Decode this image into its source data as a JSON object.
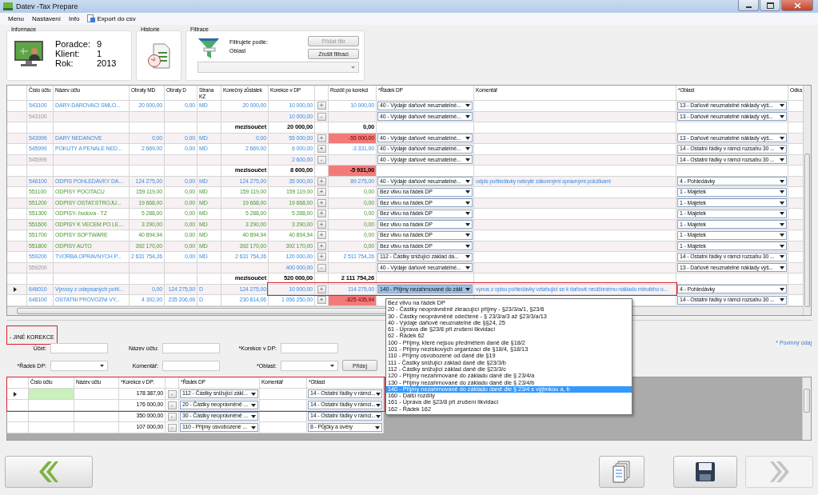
{
  "window": {
    "title": "Datev -Tax Prepare"
  },
  "menu": [
    "Menu",
    "Nastavení",
    "Info",
    "Export do csv"
  ],
  "info_group": {
    "title": "Informace",
    "fields": [
      {
        "label": "Poradce:",
        "value": "9"
      },
      {
        "label": "Klient:",
        "value": "1"
      },
      {
        "label": "Rok:",
        "value": "2013"
      }
    ]
  },
  "history_group": {
    "title": "Historie"
  },
  "filter_group": {
    "title": "Filtrace",
    "caption": "Filtrujete podle:",
    "value": "Oblast",
    "add_button": {
      "label": "Přidat filtr",
      "disabled": true
    },
    "cancel_button": {
      "label": "Zrušit filtraci",
      "disabled": false
    }
  },
  "main_grid": {
    "columns": [
      "Číslo účtu",
      "Název účtu",
      "Obraty MD",
      "Obraty D",
      "Strana KZ",
      "Konečný zůstatek",
      "Korekce v DP",
      "Rozdíl po korekci",
      "*Řádek DP",
      "Komentář",
      "*Oblast",
      "Odka"
    ],
    "rows": [
      {
        "kind": "account",
        "selected": false,
        "cislo": "543100",
        "nazev": "DARY-DAROVACI SMLO...",
        "md": "20 000,00",
        "d": "0,00",
        "strana": "MD",
        "konecny": "20 000,00",
        "korekce": "10 000,00",
        "button": "+",
        "rozdil": "10 000,00",
        "rozdil_alert": false,
        "radek": "40 - Výdaje daňově neuznatelné...",
        "oblast": "13 - Daňově neuznatelné náklady výš..."
      },
      {
        "kind": "split",
        "selected": false,
        "cislo": "543100",
        "korekce": "10 000,00",
        "button": "-",
        "radek": "40 - Výdaje daňově neuznatelné...",
        "oblast": "13 - Daňově neuznatelné náklady výš..."
      },
      {
        "kind": "subtotal",
        "selected": false,
        "label": "mezisoučet",
        "korekce": "20 000,00",
        "rozdil": "0,00",
        "rozdil_alert": false
      },
      {
        "kind": "account",
        "selected": false,
        "cislo": "543999",
        "nazev": "DARY NEDANOVE",
        "md": "0,00",
        "d": "0,00",
        "strana": "MD",
        "konecny": "0,00",
        "korekce": "55 000,00",
        "button": "+",
        "rozdil": "-55 000,00",
        "rozdil_alert": true,
        "radek": "40 - Výdaje daňově neuznatelné...",
        "oblast": "13 - Daňově neuznatelné náklady výš..."
      },
      {
        "kind": "account",
        "selected": false,
        "cislo": "545999",
        "nazev": "POKUTY A PENALE NED...",
        "md": "2 669,00",
        "d": "0,00",
        "strana": "MD",
        "konecny": "2 669,00",
        "korekce": "6 000,00",
        "button": "+",
        "rozdil": "-3 331,00",
        "rozdil_alert": false,
        "radek": "40 - Výdaje daňově neuznatelné...",
        "oblast": "14 - Ostatní řádky v rámci rozsahu 30 ..."
      },
      {
        "kind": "split",
        "selected": false,
        "cislo": "545999",
        "korekce": "2 600,00",
        "button": "-",
        "radek": "40 - Výdaje daňově neuznatelné...",
        "oblast": "14 - Ostatní řádky v rámci rozsahu 30 ..."
      },
      {
        "kind": "subtotal",
        "selected": false,
        "label": "mezisoučet",
        "korekce": "8 600,00",
        "rozdil": "-5 931,00",
        "rozdil_alert": true
      },
      {
        "kind": "account",
        "selected": false,
        "cislo": "546100",
        "nazev": "ODPIS POHLEDAVKY DA...",
        "md": "124 275,00",
        "d": "0,00",
        "strana": "MD",
        "konecny": "124 275,00",
        "korekce": "35 000,00",
        "button": "+",
        "rozdil": "89 275,00",
        "rozdil_alert": false,
        "radek": "40 - Výdaje daňově neuznatelné...",
        "komentar": "odpis pohledávky nekryté zákonnými opravnými položkami",
        "oblast": "4 - Pohledávky"
      },
      {
        "kind": "depreciation",
        "selected": false,
        "cislo": "551100",
        "nazev": "ODPISY POCITACU",
        "md": "159 119,00",
        "d": "0,00",
        "strana": "MD",
        "konecny": "159 119,00",
        "korekce": "159 119,00",
        "button": "+",
        "rozdil": "0,00",
        "rozdil_alert": false,
        "radek": "Bez vlivu na řádek DP",
        "oblast": "1 - Majetek"
      },
      {
        "kind": "depreciation",
        "selected": false,
        "cislo": "551200",
        "nazev": "ODPISY OSTAT.STROJU...",
        "md": "19 668,00",
        "d": "0,00",
        "strana": "MD",
        "konecny": "19 668,00",
        "korekce": "19 668,00",
        "button": "+",
        "rozdil": "0,00",
        "rozdil_alert": false,
        "radek": "Bez vlivu na řádek DP",
        "oblast": "1 - Majetek"
      },
      {
        "kind": "depreciation",
        "selected": false,
        "cislo": "551300",
        "nazev": "ODPISY- budova - TZ",
        "md": "5 288,00",
        "d": "0,00",
        "strana": "MD",
        "konecny": "5 288,00",
        "korekce": "5 288,00",
        "button": "+",
        "rozdil": "0,00",
        "rozdil_alert": false,
        "radek": "Bez vlivu na řádek DP",
        "oblast": "1 - Majetek"
      },
      {
        "kind": "depreciation",
        "selected": false,
        "cislo": "551600",
        "nazev": "ODPISY K VECEM PO LE...",
        "md": "3 290,00",
        "d": "0,00",
        "strana": "MD",
        "konecny": "3 290,00",
        "korekce": "3 290,00",
        "button": "+",
        "rozdil": "0,00",
        "rozdil_alert": false,
        "radek": "Bez vlivu na řádek DP",
        "oblast": "1 - Majetek"
      },
      {
        "kind": "depreciation",
        "selected": false,
        "cislo": "551700",
        "nazev": "ODPISY SOFTWARE",
        "md": "40 894,94",
        "d": "0,00",
        "strana": "MD",
        "konecny": "40 894,94",
        "korekce": "40 894,94",
        "button": "+",
        "rozdil": "0,00",
        "rozdil_alert": false,
        "radek": "Bez vlivu na řádek DP",
        "oblast": "1 - Majetek"
      },
      {
        "kind": "depreciation",
        "selected": false,
        "cislo": "551800",
        "nazev": "ODPISY AUTO",
        "md": "392 170,00",
        "d": "0,00",
        "strana": "MD",
        "konecny": "392 170,00",
        "korekce": "392 170,00",
        "button": "+",
        "rozdil": "0,00",
        "rozdil_alert": false,
        "radek": "Bez vlivu na řádek DP",
        "oblast": "1 - Majetek"
      },
      {
        "kind": "account",
        "selected": false,
        "cislo": "559200",
        "nazev": "TVORBA OPRAVNYCH P...",
        "md": "2 631 754,26",
        "d": "0,00",
        "strana": "MD",
        "konecny": "2 631 754,26",
        "korekce": "120 000,00",
        "button": "+",
        "rozdil": "2 511 754,26",
        "rozdil_alert": false,
        "radek": "112 - Částky snižující základ da...",
        "oblast": "14 - Ostatní řádky v rámci rozsahu 30 ..."
      },
      {
        "kind": "split",
        "selected": false,
        "cislo": "559200",
        "korekce": "400 000,00",
        "button": "-",
        "radek": "40 - Výdaje daňově neuznatelné...",
        "oblast": "13 - Daňově neuznatelné náklady výš..."
      },
      {
        "kind": "subtotal",
        "selected": false,
        "label": "mezisoučet",
        "korekce": "520 000,00",
        "rozdil": "2 111 754,26",
        "rozdil_alert": false
      },
      {
        "kind": "account",
        "selected": true,
        "cislo": "646010",
        "nazev": "Výnosy z odepsaných pohl...",
        "md": "0,00",
        "d": "124 275,00",
        "strana": "D",
        "konecny": "124 275,00",
        "korekce": "10 000,00",
        "button": "+",
        "rozdil": "114 275,00",
        "rozdil_alert": false,
        "radek": "140 - Příjmy nezahrnované do zákl",
        "komentar": "výnos z opisu pohledávky vztahující se k daňově neúčinnému nákladu minulého o...",
        "oblast": "4 - Pohledávky"
      },
      {
        "kind": "account",
        "selected": false,
        "cislo": "648100",
        "nazev": "OSTATNI PROVOZNI VY...",
        "md": "4 392,00",
        "d": "235 206,06",
        "strana": "D",
        "konecny": "230 814,06",
        "korekce": "1 056 250,00",
        "button": "+",
        "rozdil": "-825 435,94",
        "rozdil_alert": true,
        "oblast": "14 - Ostatní řádky v rámci rozsahu 30 ..."
      }
    ]
  },
  "dropdown": {
    "options": [
      {
        "label": "Bez vlivu na řádek DP",
        "selected": false
      },
      {
        "label": "20 - Částky neoprávněně zkracující příjmy - §23/3/a/1, §23/6",
        "selected": false
      },
      {
        "label": "30 - Částky neoprávněně odečtené - § 23/3/a/3 až §23/3/a/13",
        "selected": false
      },
      {
        "label": "40 - Výdaje daňově neuznatelné dle §§24, 25",
        "selected": false
      },
      {
        "label": "61 - Úprava dle §23/8 při zrušení likvidací",
        "selected": false
      },
      {
        "label": "62 - Řádek 62",
        "selected": false
      },
      {
        "label": "100 - Příjmy, které nejsou předmětem daně dle §18/2",
        "selected": false
      },
      {
        "label": "101 - Příjmy neziskových organizací dle §18/4, §18/13",
        "selected": false
      },
      {
        "label": "110 - Příjmy osvobozené od daně dle §19",
        "selected": false
      },
      {
        "label": "111 - Částky snižující základ daně dle §23/3/b",
        "selected": false
      },
      {
        "label": "112 - Částky snižující základ daně dle §23/3/c",
        "selected": false
      },
      {
        "label": "120 - Příjmy nezahrnované do základu daně dle § 23/4/a",
        "selected": false
      },
      {
        "label": "130 - Příjmy nezahrnované do základu daně dle § 23/4/b",
        "selected": false
      },
      {
        "label": "140 - Příjmy nezahrnované do základu daně dle § 23/4 s výjimkou a, b",
        "selected": true
      },
      {
        "label": "160 - Další rozdíly",
        "selected": false
      },
      {
        "label": "161 - Úprava dle §23/8 při zrušení likvidací",
        "selected": false
      },
      {
        "label": "162 - Řádek 162",
        "selected": false
      }
    ]
  },
  "other_corrections": {
    "title": "- JINÉ KOREKCE",
    "required_note": "* Povinný údaj",
    "fields": [
      {
        "label": "Účet:",
        "kind": "text"
      },
      {
        "label": "Název účtu:",
        "kind": "text"
      },
      {
        "label": "*Korekce v DP:",
        "kind": "text"
      },
      {
        "label": "*Řádek DP:",
        "kind": "combo"
      },
      {
        "label": "Komentář:",
        "kind": "text"
      },
      {
        "label": "*Oblast:",
        "kind": "combo"
      }
    ],
    "add_button": "Přidej",
    "grid": {
      "columns": [
        "Číslo účtu",
        "Název účtu",
        "*Korekce v DP:",
        "*Řádek DP",
        "Komentář",
        "*Oblast"
      ],
      "rows": [
        {
          "selected": true,
          "korekce": "178 387,00",
          "button": "-",
          "radek": "112 - Částky snižující zákl...",
          "oblast": "14 - Ostatní řádky v rámci..."
        },
        {
          "selected": false,
          "korekce": "176 000,00",
          "button": "-",
          "radek": "20 - Částky neoprávněně ...",
          "oblast": "14 - Ostatní řádky v rámci..."
        },
        {
          "selected": false,
          "korekce": "350 000,00",
          "button": "-",
          "radek": "30 - Částky neoprávněně ...",
          "oblast": "14 - Ostatní řádky v rámci..."
        },
        {
          "selected": false,
          "korekce": "107 000,00",
          "button": "-",
          "radek": "110 - Příjmy osvobozené ...",
          "oblast": "8 - Půjčky a úvěry"
        }
      ]
    }
  },
  "footer_buttons": [
    {
      "kind": "back",
      "disabled": false
    },
    {
      "kind": "documents",
      "disabled": false
    },
    {
      "kind": "save",
      "disabled": false
    },
    {
      "kind": "forward",
      "disabled": true
    }
  ]
}
